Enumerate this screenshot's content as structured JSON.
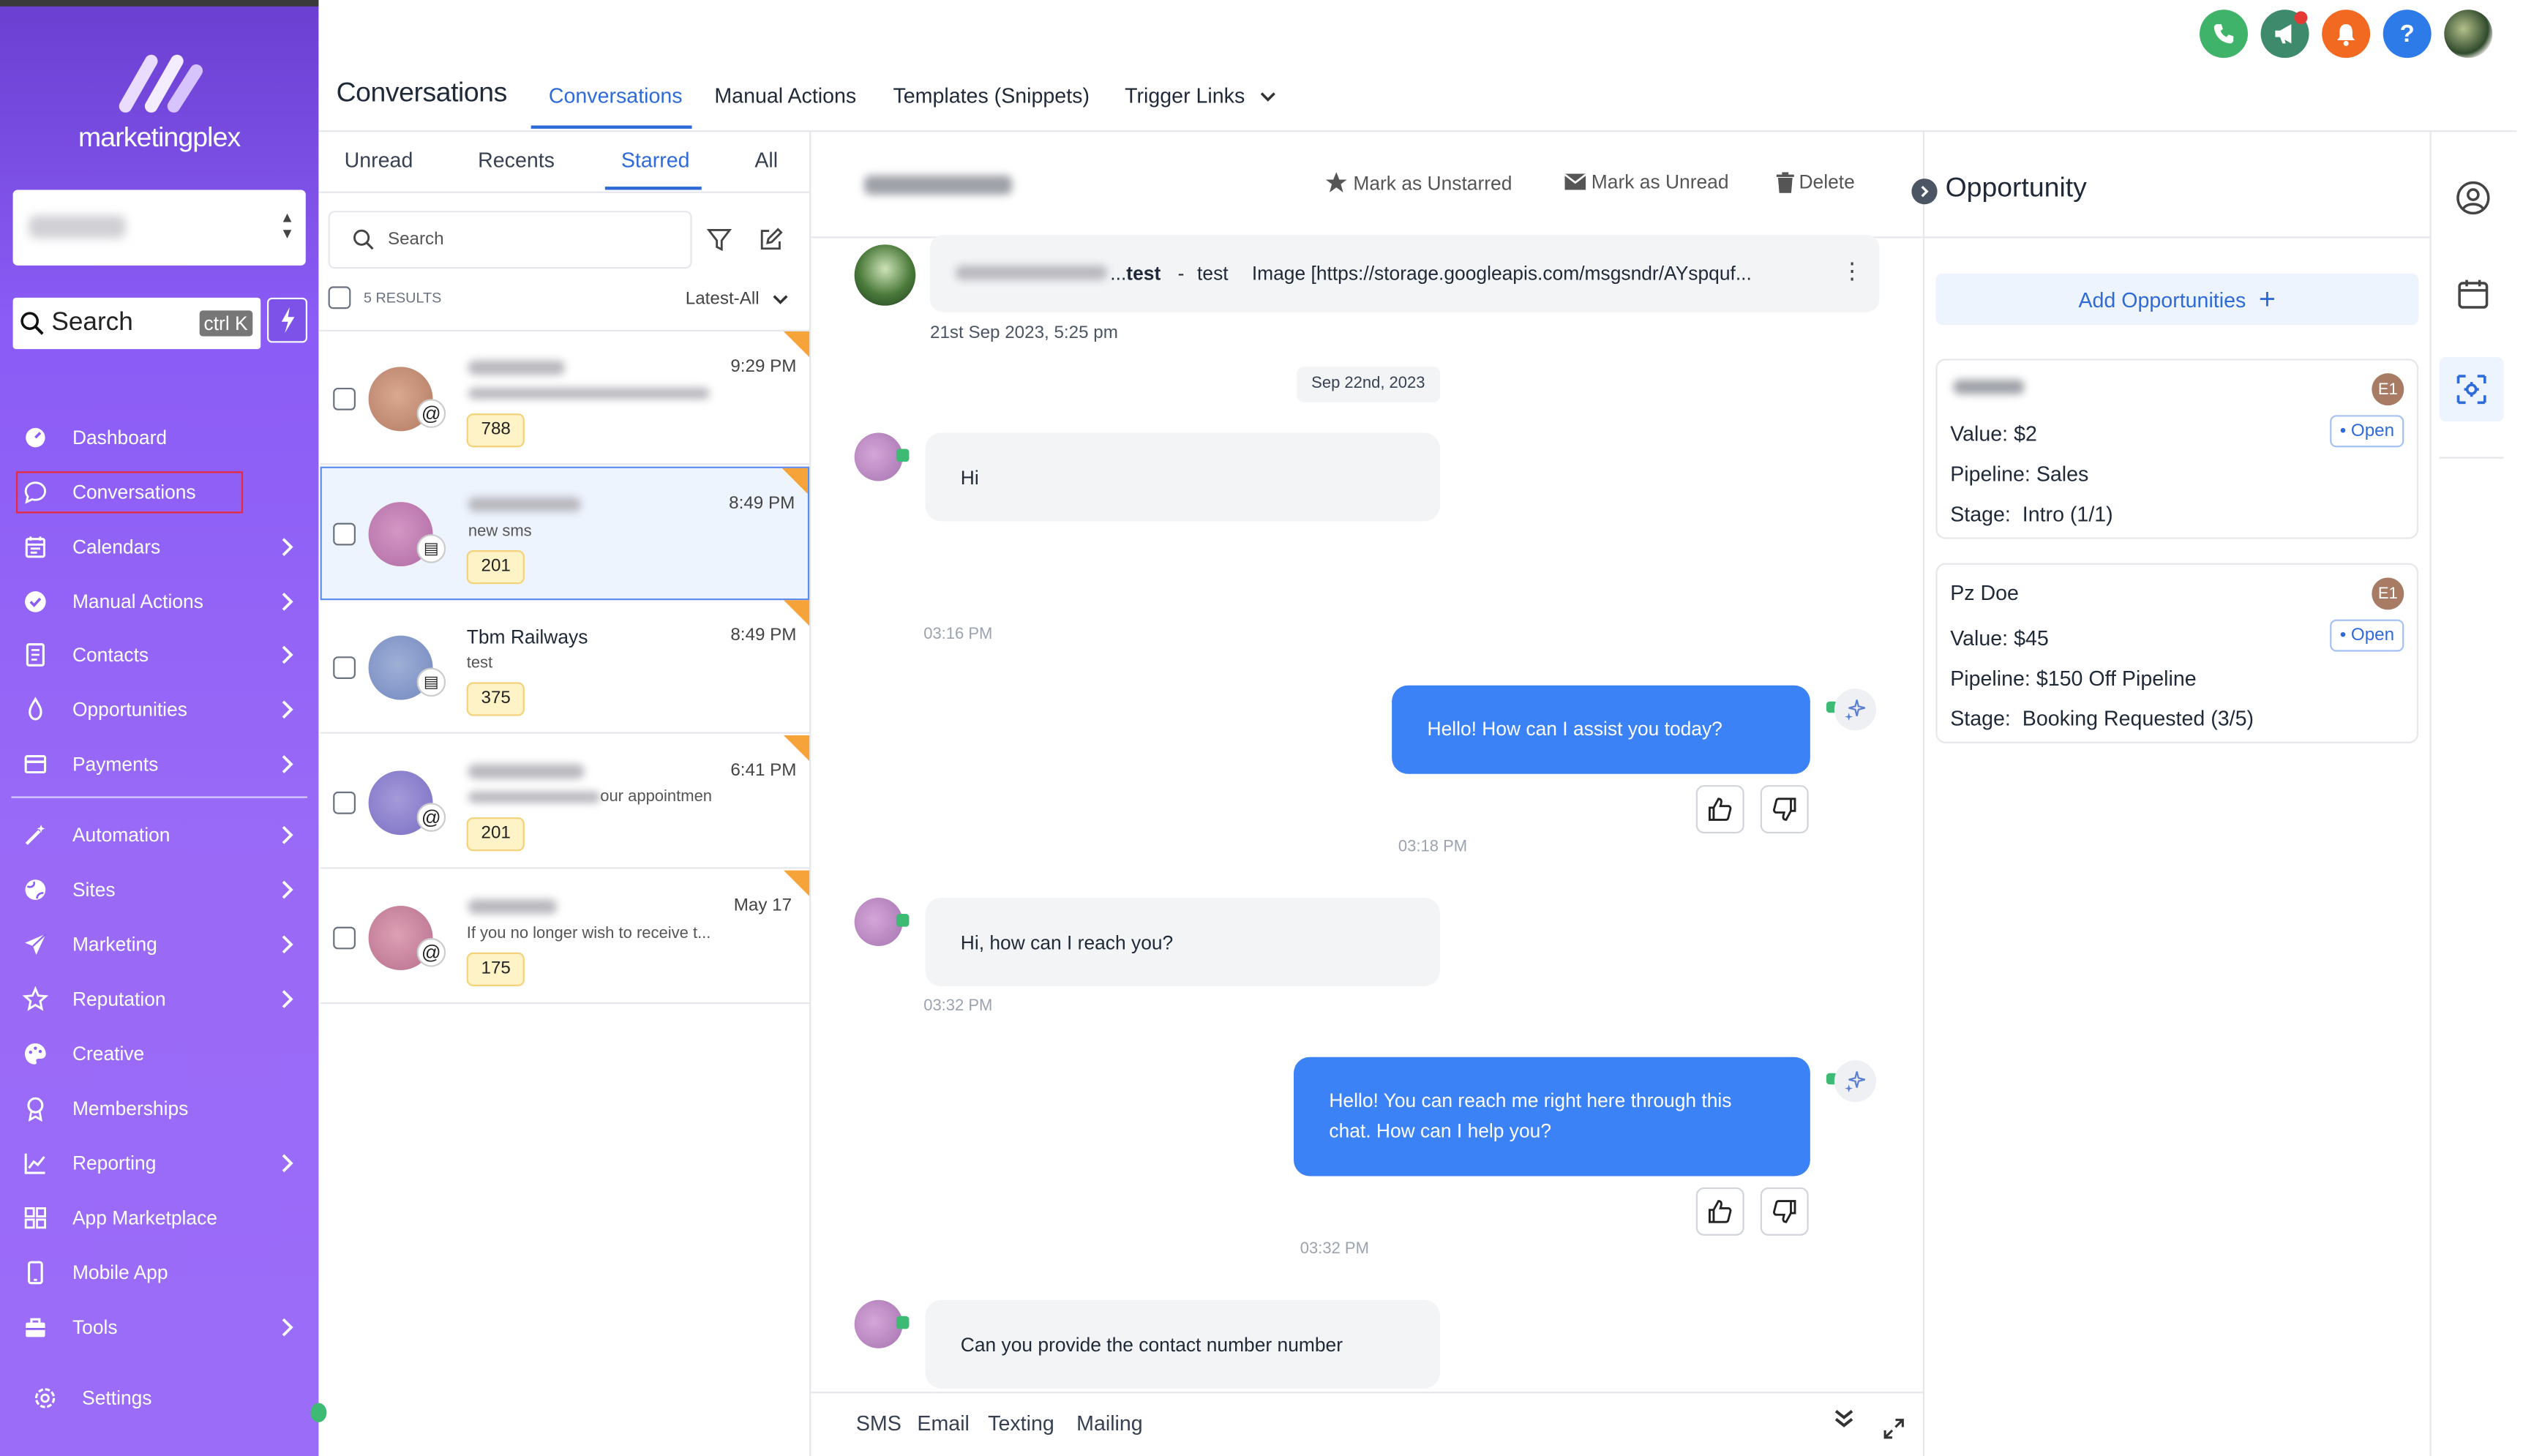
{
  "app": {
    "brand": "marketingplex",
    "page_title": "Conversations",
    "colors": {
      "sidebar": "#8b5cf6",
      "accent": "#2f6bd8",
      "bubble_out": "#3b82f6",
      "badge_bg": "#fef3c7",
      "star": "#f6a43a"
    }
  },
  "sidebar": {
    "search_label": "Search",
    "search_shortcut": "ctrl K",
    "items": [
      {
        "label": "Dashboard",
        "icon": "dashboard-icon",
        "chevron": false
      },
      {
        "label": "Conversations",
        "icon": "chat-icon",
        "chevron": false
      },
      {
        "label": "Calendars",
        "icon": "calendar-icon",
        "chevron": true
      },
      {
        "label": "Manual Actions",
        "icon": "check-circle-icon",
        "chevron": true
      },
      {
        "label": "Contacts",
        "icon": "contact-book-icon",
        "chevron": true
      },
      {
        "label": "Opportunities",
        "icon": "filter-funnel-icon",
        "chevron": true
      },
      {
        "label": "Payments",
        "icon": "payment-icon",
        "chevron": true
      },
      {
        "label": "Automation",
        "icon": "magic-wand-icon",
        "chevron": true
      },
      {
        "label": "Sites",
        "icon": "globe-icon",
        "chevron": true
      },
      {
        "label": "Marketing",
        "icon": "paper-plane-icon",
        "chevron": true
      },
      {
        "label": "Reputation",
        "icon": "star-icon",
        "chevron": true
      },
      {
        "label": "Creative",
        "icon": "palette-icon",
        "chevron": false
      },
      {
        "label": "Memberships",
        "icon": "badge-icon",
        "chevron": false
      },
      {
        "label": "Reporting",
        "icon": "chart-icon",
        "chevron": true
      },
      {
        "label": "App Marketplace",
        "icon": "grid-icon",
        "chevron": false
      },
      {
        "label": "Mobile App",
        "icon": "mobile-icon",
        "chevron": false
      },
      {
        "label": "Tools",
        "icon": "toolbox-icon",
        "chevron": true
      }
    ],
    "settings_label": "Settings"
  },
  "header": {
    "title": "Conversations",
    "tabs": [
      {
        "label": "Conversations",
        "active": true
      },
      {
        "label": "Manual Actions",
        "active": false
      },
      {
        "label": "Templates (Snippets)",
        "active": false
      },
      {
        "label": "Trigger Links",
        "active": false
      }
    ]
  },
  "list": {
    "filters": [
      "Unread",
      "Recents",
      "Starred",
      "All"
    ],
    "active_filter": "Starred",
    "search_placeholder": "Search",
    "results_label": "5 RESULTS",
    "sort_label": "Latest-All",
    "conversations": [
      {
        "name": "",
        "time": "9:29 PM",
        "preview": "",
        "count": "788",
        "channel": "@"
      },
      {
        "name": "",
        "time": "8:49 PM",
        "preview": "new sms",
        "count": "201",
        "channel": "sms"
      },
      {
        "name": "Tbm Railways",
        "time": "8:49 PM",
        "preview": "test",
        "count": "375",
        "channel": "sms"
      },
      {
        "name": "",
        "time": "6:41 PM",
        "preview": "our appointmen",
        "count": "201",
        "channel": "@"
      },
      {
        "name": "",
        "time": "May 17",
        "preview": "If you no longer wish to receive t...",
        "count": "175",
        "channel": "@"
      }
    ]
  },
  "chat": {
    "actions": {
      "unstar": "Mark as Unstarred",
      "unread": "Mark as Unread",
      "delete": "Delete"
    },
    "email_preview": {
      "subject": "test",
      "sep": "-",
      "body": "test",
      "attachment": "Image [https://storage.googleapis.com/msgsndr/AYspquf...",
      "timestamp": "21st Sep 2023, 5:25 pm"
    },
    "date_divider": "Sep 22nd, 2023",
    "messages": [
      {
        "dir": "in",
        "text": "Hi",
        "time": "03:16 PM"
      },
      {
        "dir": "out",
        "text": "Hello! How can I assist you today?",
        "time": "03:18 PM"
      },
      {
        "dir": "in",
        "text": "Hi, how can I reach you?",
        "time": "03:32 PM"
      },
      {
        "dir": "out",
        "text": "Hello! You can reach me right here through this chat. How can I help you?",
        "time": "03:32 PM"
      },
      {
        "dir": "in",
        "text": "Can you provide the contact number number",
        "time": ""
      }
    ],
    "compose_tabs": [
      "SMS",
      "Email",
      "Texting",
      "Mailing"
    ]
  },
  "opportunity": {
    "title": "Opportunity",
    "add_label": "Add Opportunities",
    "cards": [
      {
        "name": "",
        "owner": "E1",
        "value_label": "Value:",
        "value": "$2",
        "status": "Open",
        "pipeline_label": "Pipeline:",
        "pipeline": "Sales",
        "stage_label": "Stage:",
        "stage": "Intro (1/1)"
      },
      {
        "name": "Pz Doe",
        "owner": "E1",
        "value_label": "Value:",
        "value": "$45",
        "status": "Open",
        "pipeline_label": "Pipeline:",
        "pipeline": "$150 Off Pipeline",
        "stage_label": "Stage:",
        "stage": "Booking Requested (3/5)"
      }
    ]
  }
}
